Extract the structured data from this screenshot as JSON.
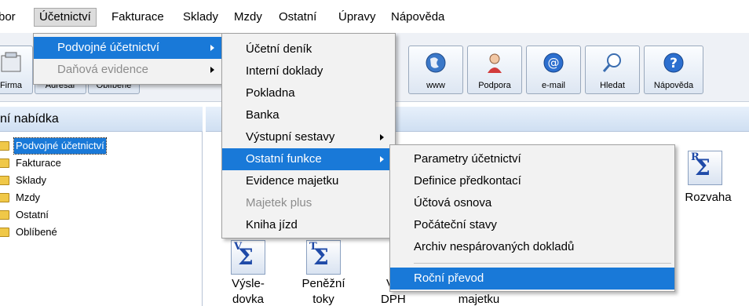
{
  "menubar": {
    "items": [
      "bor",
      "Účetnictví",
      "Fakturace",
      "Sklady",
      "Mzdy",
      "Ostatní",
      "Úpravy",
      "Nápověda"
    ]
  },
  "toolbar": {
    "left_labels": [
      "Firma",
      "Adresář",
      "Oblíbené"
    ],
    "buttons": [
      {
        "label": "www",
        "icon": "globe-icon"
      },
      {
        "label": "Podpora",
        "icon": "support-person-icon"
      },
      {
        "label": "e-mail",
        "icon": "email-at-icon"
      },
      {
        "label": "Hledat",
        "icon": "search-magnifier-icon"
      },
      {
        "label": "Nápověda",
        "icon": "help-question-icon"
      }
    ]
  },
  "left_panel": {
    "title": "ní nabídka",
    "tree": [
      "Podvojné účetnictví",
      "Fakturace",
      "Sklady",
      "Mzdy",
      "Ostatní",
      "Oblíbené"
    ],
    "selected_index": 0
  },
  "content": {
    "icons": [
      {
        "letter": "V",
        "caption_lines": [
          "Výsle-",
          "dovka"
        ]
      },
      {
        "letter": "T",
        "caption_lines": [
          "Peněžní",
          "toky"
        ]
      },
      {
        "letter": "R",
        "caption_lines": [
          "Rozvaha"
        ]
      }
    ],
    "partial_captions": [
      "V",
      "DPH",
      "majetku"
    ]
  },
  "menu_ucetnictvi": {
    "items": [
      {
        "label": "Podvojné účetnictví",
        "highlighted": true,
        "disabled": false,
        "submenu": true
      },
      {
        "label": "Daňová evidence",
        "highlighted": false,
        "disabled": true,
        "submenu": true
      }
    ]
  },
  "menu_podvojne": {
    "items": [
      {
        "label": "Účetní deník",
        "highlighted": false,
        "disabled": false,
        "submenu": false
      },
      {
        "label": "Interní doklady",
        "highlighted": false,
        "disabled": false,
        "submenu": false
      },
      {
        "label": "Pokladna",
        "highlighted": false,
        "disabled": false,
        "submenu": false
      },
      {
        "label": "Banka",
        "highlighted": false,
        "disabled": false,
        "submenu": false
      },
      {
        "label": "Výstupní sestavy",
        "highlighted": false,
        "disabled": false,
        "submenu": true
      },
      {
        "label": "Ostatní funkce",
        "highlighted": true,
        "disabled": false,
        "submenu": true
      },
      {
        "label": "Evidence majetku",
        "highlighted": false,
        "disabled": false,
        "submenu": false
      },
      {
        "label": "Majetek plus",
        "highlighted": false,
        "disabled": true,
        "submenu": false
      },
      {
        "label": "Kniha jízd",
        "highlighted": false,
        "disabled": false,
        "submenu": false
      }
    ]
  },
  "menu_ostatni_funkce": {
    "items": [
      {
        "label": "Parametry účetnictví",
        "highlighted": false
      },
      {
        "label": "Definice předkontací",
        "highlighted": false
      },
      {
        "label": "Účtová osnova",
        "highlighted": false
      },
      {
        "label": "Počáteční stavy",
        "highlighted": false
      },
      {
        "label": "Archiv nespárovaných dokladů",
        "highlighted": false
      },
      {
        "label": "Roční převod",
        "highlighted": true
      }
    ]
  },
  "colors": {
    "highlight": "#1979d8",
    "menu_bg": "#f2f2f2",
    "disabled_text": "#8c8c8c",
    "panel_header": "#cfdff2"
  }
}
